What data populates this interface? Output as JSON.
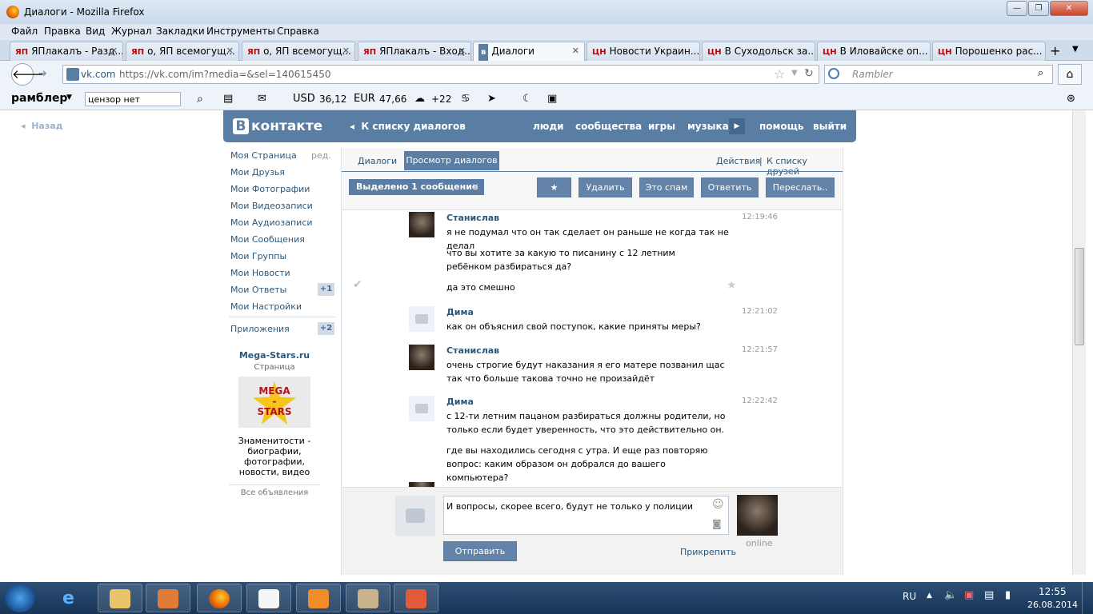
{
  "window": {
    "title": "Диалоги - Mozilla Firefox"
  },
  "menubar": [
    "Файл",
    "Правка",
    "Вид",
    "Журнал",
    "Закладки",
    "Инструменты",
    "Справка"
  ],
  "tabs": [
    {
      "icon": "ЯП",
      "label": "ЯПлакалъ - Разд..."
    },
    {
      "icon": "ЯП",
      "label": "о, ЯП всемогущ..."
    },
    {
      "icon": "ЯП",
      "label": "о, ЯП всемогущ..."
    },
    {
      "icon": "ЯП",
      "label": "ЯПлакалъ - Вход..."
    },
    {
      "icon": "",
      "label": "Диалоги"
    },
    {
      "icon": "ЦН",
      "label": "Новости Украин..."
    },
    {
      "icon": "ЦН",
      "label": "В Суходольск за..."
    },
    {
      "icon": "ЦН",
      "label": "В Иловайске оп..."
    },
    {
      "icon": "ЦН",
      "label": "Порошенко рас..."
    }
  ],
  "url": {
    "domain": "vk.com",
    "full": "https://vk.com/im?media=&sel=140615450"
  },
  "search": {
    "placeholder": "Rambler"
  },
  "rambler": {
    "brand": "рамблер",
    "query": "цензор нет",
    "usd_label": "USD",
    "usd": "36,12",
    "eur_label": "EUR",
    "eur": "47,66",
    "temp": "+22"
  },
  "page": {
    "back": "Назад",
    "vk": {
      "logo": "контакте",
      "back_to_list": "К списку диалогов",
      "nav": [
        "люди",
        "сообщества",
        "игры",
        "музыка",
        "помощь",
        "выйти"
      ]
    },
    "left_menu": {
      "items": [
        "Моя Страница",
        "Мои Друзья",
        "Мои Фотографии",
        "Мои Видеозаписи",
        "Мои Аудиозаписи",
        "Мои Сообщения",
        "Мои Группы",
        "Мои Новости",
        "Мои Ответы",
        "Мои Настройки"
      ],
      "edit": "ред.",
      "answers_count": "+1",
      "apps": "Приложения",
      "apps_count": "+2",
      "ad_title": "Mega-Stars.ru",
      "ad_sub": "Страница",
      "ad_img1": "MEGA",
      "ad_img2": "-",
      "ad_img3": "STARS",
      "ad_text": "Знаменитости - биографии, фотографии, новости, видео",
      "all_ads": "Все объявления"
    },
    "dialog": {
      "tab1": "Диалоги",
      "tab2": "Просмотр диалогов",
      "actions": "Действия",
      "sep": "|",
      "friends": "К списку друзей",
      "selected": "Выделено 1 сообщение",
      "btn_delete": "Удалить",
      "btn_spam": "Это спам",
      "btn_reply": "Ответить",
      "btn_forward": "Переслать..",
      "messages": [
        {
          "name": "Станислав",
          "time": "12:19:46",
          "lines": [
            "я не подумал что он так сделает он раньше не когда так не делал",
            "что вы хотите за какую то писанину с 12 летним ребёнком разбираться да?",
            "да это смешно"
          ]
        },
        {
          "name": "Дима",
          "time": "12:21:02",
          "lines": [
            "как он объяснил свой поступок, какие приняты меры?"
          ]
        },
        {
          "name": "Станислав",
          "time": "12:21:57",
          "lines": [
            "очень строгие будут наказания я его матере позванил щас так что больше такова точно не произайдёт"
          ]
        },
        {
          "name": "Дима",
          "time": "12:22:42",
          "lines": [
            "с 12-ти летним пацаном разбираться должны родители, но только если будет уверенность, что это действительно он.",
            "где вы находились сегодня с утра. И еще раз повторяю вопрос: каким образом он добрался до вашего компьютера?"
          ]
        }
      ],
      "compose_text": "И вопросы, скорее всего, будут не только у полиции",
      "send": "Отправить",
      "attach": "Прикрепить",
      "online": "online"
    }
  },
  "taskbar": {
    "lang": "RU",
    "time": "12:55",
    "date": "26.08.2014"
  }
}
